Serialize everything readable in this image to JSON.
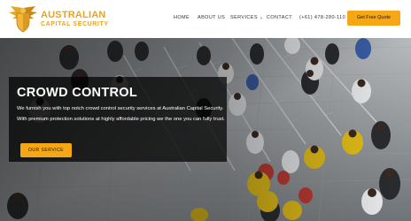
{
  "brand": {
    "name_line1": "AUSTRALIAN",
    "name_line2": "CAPITAL SECURITY",
    "color": "#e8a520"
  },
  "nav": {
    "items": [
      {
        "label": "HOME"
      },
      {
        "label": "ABOUT US"
      },
      {
        "label": "SERVICES"
      },
      {
        "label": "CONTACT"
      }
    ],
    "phone": "(+61) 478-280-110",
    "cta_label": "Get Free Quote"
  },
  "hero": {
    "title": "CROWD CONTROL",
    "description": "We furnish you with top notch crowd control security services at Australian Capital Security. With premium protection solutions at highly affordable pricing we the one you can fully trust.",
    "button_label": "OUR SERVICE"
  },
  "colors": {
    "accent": "#f5a716",
    "text_dark": "#333333",
    "overlay": "#000000"
  },
  "icons": {
    "logo": "eagle-shield-icon",
    "services_dropdown": "chevron-down-icon"
  }
}
